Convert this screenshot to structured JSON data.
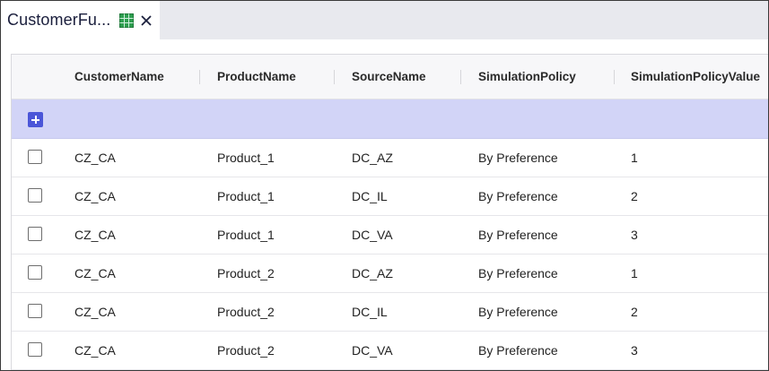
{
  "tab": {
    "title": "CustomerFu...",
    "icon": "grid-icon",
    "close_icon": "close-icon"
  },
  "table": {
    "columns": [
      "CustomerName",
      "ProductName",
      "SourceName",
      "SimulationPolicy",
      "SimulationPolicyValue"
    ],
    "rows": [
      [
        "CZ_CA",
        "Product_1",
        "DC_AZ",
        "By Preference",
        "1"
      ],
      [
        "CZ_CA",
        "Product_1",
        "DC_IL",
        "By Preference",
        "2"
      ],
      [
        "CZ_CA",
        "Product_1",
        "DC_VA",
        "By Preference",
        "3"
      ],
      [
        "CZ_CA",
        "Product_2",
        "DC_AZ",
        "By Preference",
        "1"
      ],
      [
        "CZ_CA",
        "Product_2",
        "DC_IL",
        "By Preference",
        "2"
      ],
      [
        "CZ_CA",
        "Product_2",
        "DC_VA",
        "By Preference",
        "3"
      ]
    ]
  },
  "colors": {
    "accent": "#4b56d8",
    "add_row_bg": "#d2d4f7",
    "grid_icon_green": "#2e9e4f"
  }
}
